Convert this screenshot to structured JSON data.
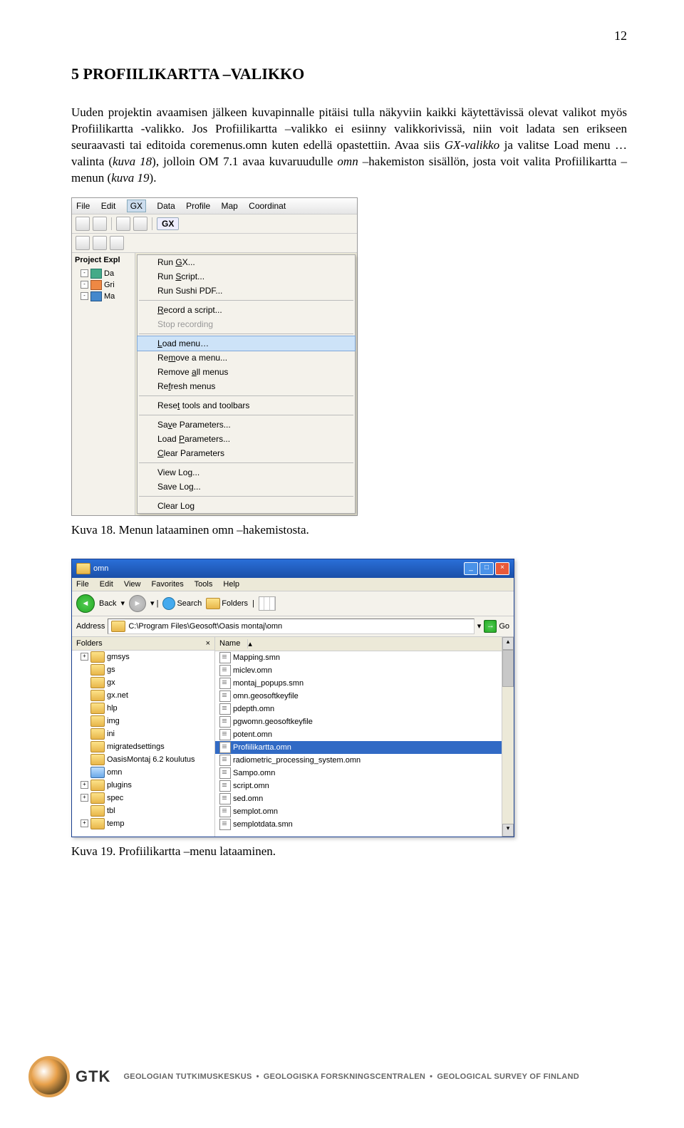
{
  "page_number": "12",
  "section_heading": "5   PROFIILIKARTTA –VALIKKO",
  "body": {
    "p1a": "Uuden projektin avaamisen jälkeen kuvapinnalle pitäisi tulla näkyviin kaikki käytettävissä olevat valikot myös Profiilikartta -valikko. Jos Profiilikartta –valikko ei esiinny valikkorivissä, niin voit ladata sen erikseen seuraavasti tai editoida coremenus.omn kuten edellä opastettiin. Avaa siis ",
    "p1b": "GX-valikko",
    "p1c": " ja valitse Load menu … valinta (",
    "p1d": "kuva 18",
    "p1e": "), jolloin OM 7.1 avaa kuvaruudulle ",
    "p1f": "omn",
    "p1g": " –hakemiston sisällön, josta voit valita Profiilikartta –menun (",
    "p1h": "kuva 19",
    "p1i": ")."
  },
  "caption1": "Kuva 18. Menun lataaminen omn –hakemistosta.",
  "caption2": "Kuva 19. Profiilikartta –menu lataaminen.",
  "shot1": {
    "menubar": [
      "File",
      "Edit",
      "GX",
      "Data",
      "Profile",
      "Map",
      "Coordinat"
    ],
    "gx_label": "GX",
    "project": "Project Expl",
    "tree": [
      "Da",
      "Gri",
      "Ma"
    ],
    "dropdown": [
      {
        "label": "Run GX...",
        "u": "G"
      },
      {
        "label": "Run Script...",
        "u": "S"
      },
      {
        "label": "Run Sushi PDF...",
        "u": ""
      },
      {
        "sep": true
      },
      {
        "label": "Record a script...",
        "u": "R"
      },
      {
        "label": "Stop recording",
        "u": "",
        "disabled": true
      },
      {
        "sep": true
      },
      {
        "label": "Load menu",
        "u": "L",
        "highlight": true
      },
      {
        "label": "Remove a menu...",
        "u": "m"
      },
      {
        "label": "Remove all menus",
        "u": "a"
      },
      {
        "label": "Refresh menus",
        "u": "f"
      },
      {
        "sep": true
      },
      {
        "label": "Reset tools and toolbars",
        "u": "t"
      },
      {
        "sep": true
      },
      {
        "label": "Save Parameters...",
        "u": "v"
      },
      {
        "label": "Load Parameters...",
        "u": "P"
      },
      {
        "label": "Clear Parameters",
        "u": "C"
      },
      {
        "sep": true
      },
      {
        "label": "View Log...",
        "u": ""
      },
      {
        "label": "Save Log...",
        "u": ""
      },
      {
        "sep": true
      },
      {
        "label": "Clear Log",
        "u": ""
      }
    ]
  },
  "shot2": {
    "title": "omn",
    "menubar": [
      "File",
      "Edit",
      "View",
      "Favorites",
      "Tools",
      "Help"
    ],
    "nav_back": "Back",
    "nav_search": "Search",
    "nav_folders": "Folders",
    "address_label": "Address",
    "address_value": "C:\\Program Files\\Geosoft\\Oasis montaj\\omn",
    "go": "Go",
    "folders_title": "Folders",
    "name_col": "Name",
    "folders": [
      {
        "name": "gmsys",
        "exp": "+"
      },
      {
        "name": "gs"
      },
      {
        "name": "gx"
      },
      {
        "name": "gx.net"
      },
      {
        "name": "hlp"
      },
      {
        "name": "img"
      },
      {
        "name": "ini"
      },
      {
        "name": "migratedsettings"
      },
      {
        "name": "OasisMontaj 6.2 koulutus"
      },
      {
        "name": "omn",
        "open": true
      },
      {
        "name": "plugins",
        "exp": "+"
      },
      {
        "name": "spec",
        "exp": "+"
      },
      {
        "name": "tbl"
      },
      {
        "name": "temp",
        "exp": "+"
      }
    ],
    "files": [
      "Mapping.smn",
      "miclev.omn",
      "montaj_popups.smn",
      "omn.geosoftkeyfile",
      "pdepth.omn",
      "pgwomn.geosoftkeyfile",
      "potent.omn",
      "Profiilikartta.omn",
      "radiometric_processing_system.omn",
      "Sampo.omn",
      "script.omn",
      "sed.omn",
      "semplot.omn",
      "semplotdata.smn"
    ],
    "selected_file": "Profiilikartta.omn"
  },
  "footer": {
    "logo_text": "GTK",
    "text1": "GEOLOGIAN TUTKIMUSKESKUS",
    "text2": "GEOLOGISKA FORSKNINGSCENTRALEN",
    "text3": "GEOLOGICAL SURVEY OF FINLAND"
  }
}
